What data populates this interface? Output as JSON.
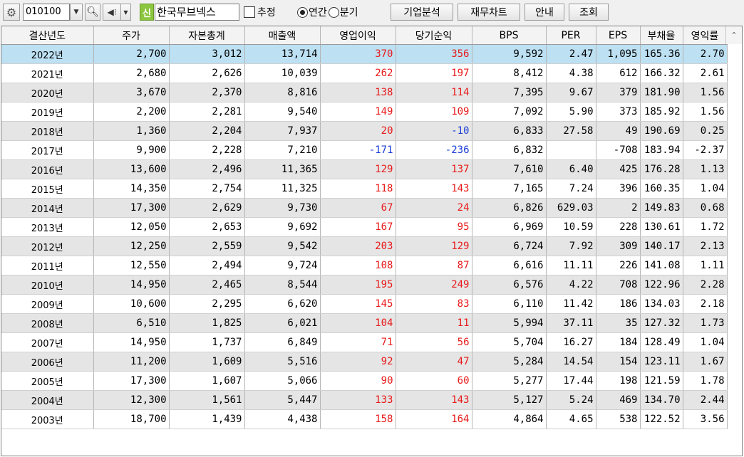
{
  "toolbar": {
    "gear_icon": "gear-icon",
    "stock_code": "010100",
    "new_badge": "신",
    "company_name": "한국무브넥스",
    "estimate_label": "추정",
    "annual_label": "연간",
    "quarter_label": "분기",
    "annual_selected": true,
    "buttons": {
      "company_analysis": "기업분석",
      "financial_chart": "재무차트",
      "guide": "안내",
      "query": "조회"
    }
  },
  "table": {
    "columns": [
      "결산년도",
      "주가",
      "자본총계",
      "매출액",
      "영업이익",
      "당기순익",
      "BPS",
      "PER",
      "EPS",
      "부채율",
      "영익률"
    ],
    "rows": [
      [
        "2022년",
        "2,700",
        "3,012",
        "13,714",
        "370",
        "356",
        "9,592",
        "2.47",
        "1,095",
        "165.36",
        "2.70"
      ],
      [
        "2021년",
        "2,680",
        "2,626",
        "10,039",
        "262",
        "197",
        "8,412",
        "4.38",
        "612",
        "166.32",
        "2.61"
      ],
      [
        "2020년",
        "3,670",
        "2,370",
        "8,816",
        "138",
        "114",
        "7,395",
        "9.67",
        "379",
        "181.90",
        "1.56"
      ],
      [
        "2019년",
        "2,200",
        "2,281",
        "9,540",
        "149",
        "109",
        "7,092",
        "5.90",
        "373",
        "185.92",
        "1.56"
      ],
      [
        "2018년",
        "1,360",
        "2,204",
        "7,937",
        "20",
        "-10",
        "6,833",
        "27.58",
        "49",
        "190.69",
        "0.25"
      ],
      [
        "2017년",
        "9,900",
        "2,228",
        "7,210",
        "-171",
        "-236",
        "6,832",
        "",
        "-708",
        "183.94",
        "-2.37"
      ],
      [
        "2016년",
        "13,600",
        "2,496",
        "11,365",
        "129",
        "137",
        "7,610",
        "6.40",
        "425",
        "176.28",
        "1.13"
      ],
      [
        "2015년",
        "14,350",
        "2,754",
        "11,325",
        "118",
        "143",
        "7,165",
        "7.24",
        "396",
        "160.35",
        "1.04"
      ],
      [
        "2014년",
        "17,300",
        "2,629",
        "9,730",
        "67",
        "24",
        "6,826",
        "629.03",
        "2",
        "149.83",
        "0.68"
      ],
      [
        "2013년",
        "12,050",
        "2,653",
        "9,692",
        "167",
        "95",
        "6,969",
        "10.59",
        "228",
        "130.61",
        "1.72"
      ],
      [
        "2012년",
        "12,250",
        "2,559",
        "9,542",
        "203",
        "129",
        "6,724",
        "7.92",
        "309",
        "140.17",
        "2.13"
      ],
      [
        "2011년",
        "12,550",
        "2,494",
        "9,724",
        "108",
        "87",
        "6,616",
        "11.11",
        "226",
        "141.08",
        "1.11"
      ],
      [
        "2010년",
        "14,950",
        "2,465",
        "8,544",
        "195",
        "249",
        "6,576",
        "4.22",
        "708",
        "122.96",
        "2.28"
      ],
      [
        "2009년",
        "10,600",
        "2,295",
        "6,620",
        "145",
        "83",
        "6,110",
        "11.42",
        "186",
        "134.03",
        "2.18"
      ],
      [
        "2008년",
        "6,510",
        "1,825",
        "6,021",
        "104",
        "11",
        "5,994",
        "37.11",
        "35",
        "127.32",
        "1.73"
      ],
      [
        "2007년",
        "14,950",
        "1,737",
        "6,849",
        "71",
        "56",
        "5,704",
        "16.27",
        "184",
        "128.49",
        "1.04"
      ],
      [
        "2006년",
        "11,200",
        "1,609",
        "5,516",
        "92",
        "47",
        "5,284",
        "14.54",
        "154",
        "123.11",
        "1.67"
      ],
      [
        "2005년",
        "17,300",
        "1,607",
        "5,066",
        "90",
        "60",
        "5,277",
        "17.44",
        "198",
        "121.59",
        "1.78"
      ],
      [
        "2004년",
        "12,300",
        "1,561",
        "5,447",
        "133",
        "143",
        "5,127",
        "5.24",
        "469",
        "134.70",
        "2.44"
      ],
      [
        "2003년",
        "18,700",
        "1,439",
        "4,438",
        "158",
        "164",
        "4,864",
        "4.65",
        "538",
        "122.52",
        "3.56"
      ]
    ],
    "selected_row": 0,
    "colors": {
      "positive": "#e8191a",
      "negative": "#1a3dd6",
      "selected": "#bde0f3",
      "shaded": "#e5e5e5"
    }
  }
}
